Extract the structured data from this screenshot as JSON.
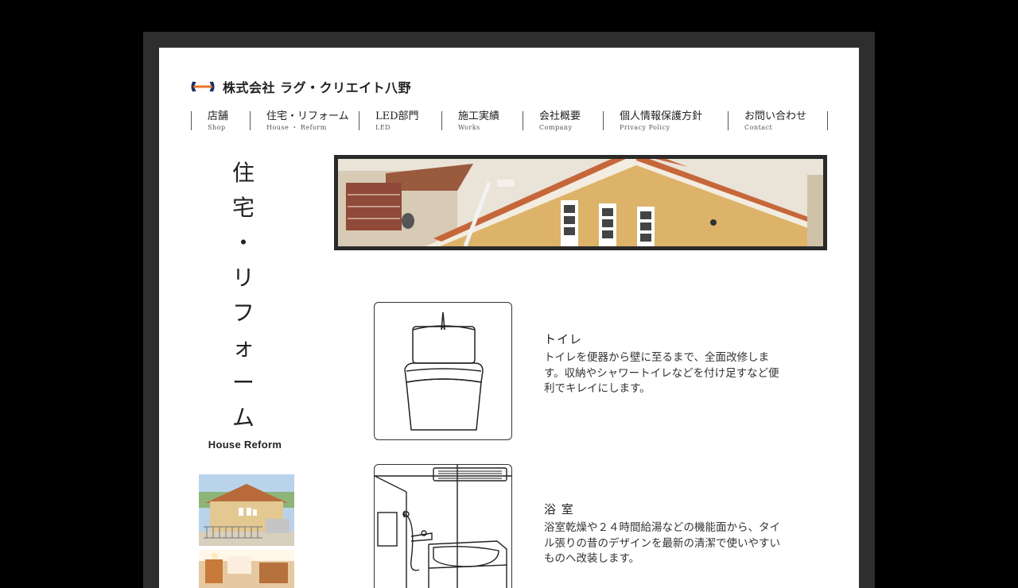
{
  "company": {
    "name": "株式会社 ラグ・クリエイト八野",
    "logo_icon": "company-logo-icon",
    "colors": {
      "navy": "#1c2e6b",
      "orange": "#e8752a"
    }
  },
  "nav": {
    "items": [
      {
        "jp": "店舗",
        "en": "Shop"
      },
      {
        "jp": "住宅・リフォーム",
        "en": "House ・ Reform"
      },
      {
        "jp": "LED部門",
        "en": "LED"
      },
      {
        "jp": "施工実績",
        "en": "Works"
      },
      {
        "jp": "会社概要",
        "en": "Company"
      },
      {
        "jp": "個人情報保護方針",
        "en": "Privacy Policy"
      },
      {
        "jp": "お問い合わせ",
        "en": "Contact"
      }
    ]
  },
  "page": {
    "vertical_title": [
      "住",
      "宅",
      "・",
      "リ",
      "フ",
      "ォ",
      "ー",
      "ム"
    ],
    "subtitle": "House Reform"
  },
  "services": [
    {
      "title": "トイレ",
      "text": "トイレを便器から壁に至るまで、全面改修します。収納やシャワートイレなどを付け足すなど便利でキレイにします。",
      "icon": "toilet-icon"
    },
    {
      "title": "浴 室",
      "text": "浴室乾燥や２４時間給湯などの機能面から、タイル張りの昔のデザインを最新の清潔で使いやすいものへ改装します。",
      "icon": "bathroom-icon"
    }
  ]
}
